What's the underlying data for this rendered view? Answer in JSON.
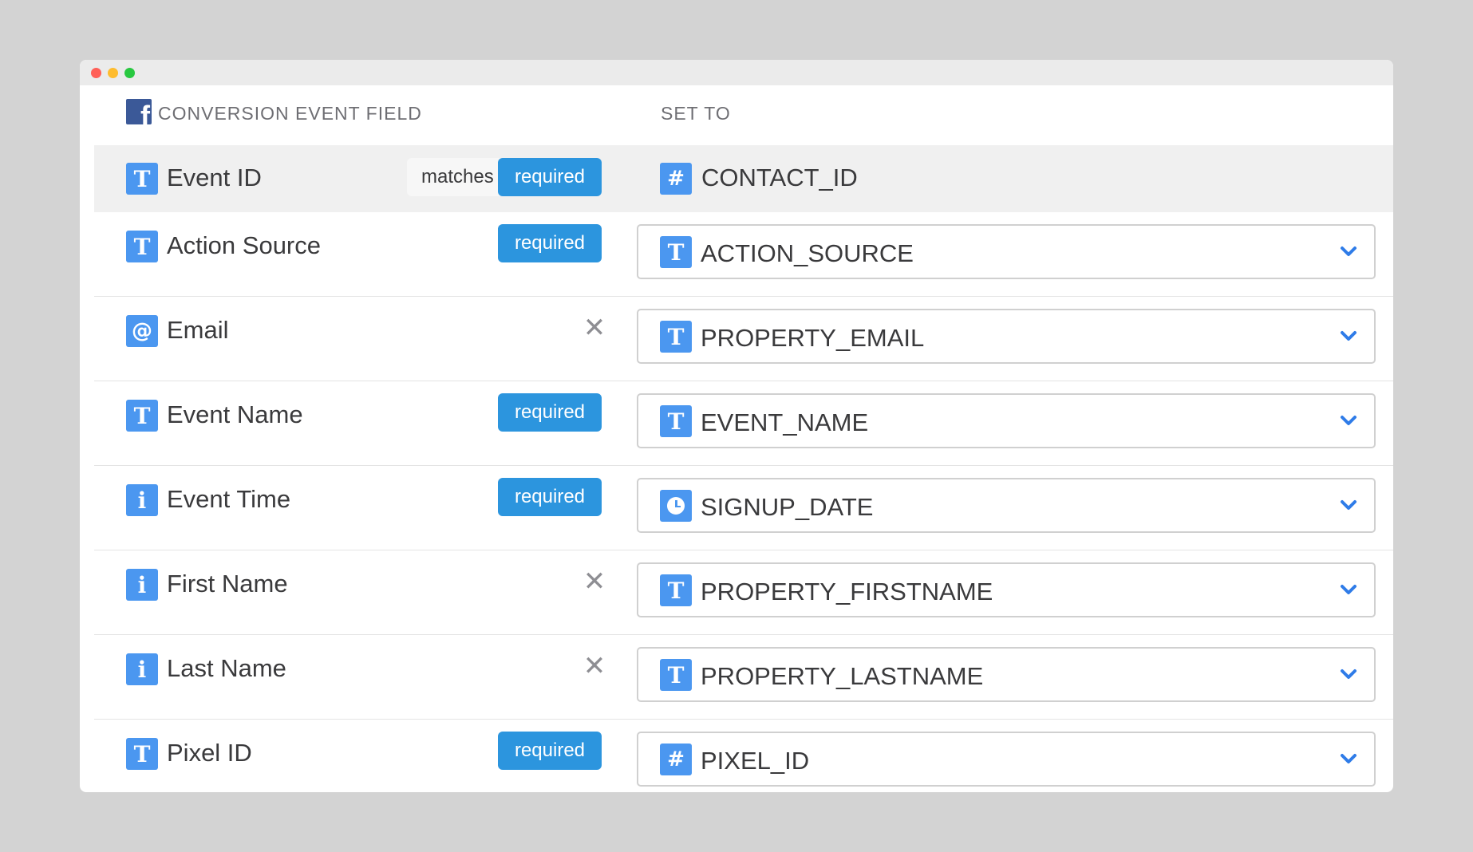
{
  "window": {
    "controls": [
      "close",
      "minimize",
      "maximize"
    ]
  },
  "header": {
    "logo_icon": "facebook-icon",
    "logo_glyph": "f",
    "left_label": "CONVERSION EVENT FIELD",
    "right_label": "SET TO"
  },
  "colors": {
    "accent": "#4b97f0",
    "required_badge": "#2c95de",
    "facebook_blue": "#3b5998",
    "chevron": "#2f7ce8"
  },
  "rows": [
    {
      "icon": "T",
      "icon_name": "text-type-icon",
      "label": "Event ID",
      "matches": "matches",
      "badge": "required",
      "value_icon": "#",
      "value_icon_name": "number-type-icon",
      "value": "CONTACT_ID",
      "editable": false
    },
    {
      "icon": "T",
      "icon_name": "text-type-icon",
      "label": "Action Source",
      "badge": "required",
      "value_icon": "T",
      "value_icon_name": "text-type-icon",
      "value": "ACTION_SOURCE"
    },
    {
      "icon": "@",
      "icon_name": "email-type-icon",
      "label": "Email",
      "removable": true,
      "remove_glyph": "✕",
      "value_icon": "T",
      "value_icon_name": "text-type-icon",
      "value": "PROPERTY_EMAIL"
    },
    {
      "icon": "T",
      "icon_name": "text-type-icon",
      "label": "Event Name",
      "badge": "required",
      "value_icon": "T",
      "value_icon_name": "text-type-icon",
      "value": "EVENT_NAME"
    },
    {
      "icon": "i",
      "icon_name": "info-type-icon",
      "label": "Event Time",
      "badge": "required",
      "value_icon": "clock",
      "value_icon_name": "clock-type-icon",
      "value": "SIGNUP_DATE"
    },
    {
      "icon": "i",
      "icon_name": "info-type-icon",
      "label": "First Name",
      "removable": true,
      "remove_glyph": "✕",
      "value_icon": "T",
      "value_icon_name": "text-type-icon",
      "value": "PROPERTY_FIRSTNAME"
    },
    {
      "icon": "i",
      "icon_name": "info-type-icon",
      "label": "Last Name",
      "removable": true,
      "remove_glyph": "✕",
      "value_icon": "T",
      "value_icon_name": "text-type-icon",
      "value": "PROPERTY_LASTNAME"
    },
    {
      "icon": "T",
      "icon_name": "text-type-icon",
      "label": "Pixel ID",
      "badge": "required",
      "value_icon": "#",
      "value_icon_name": "number-type-icon",
      "value": "PIXEL_ID"
    }
  ]
}
